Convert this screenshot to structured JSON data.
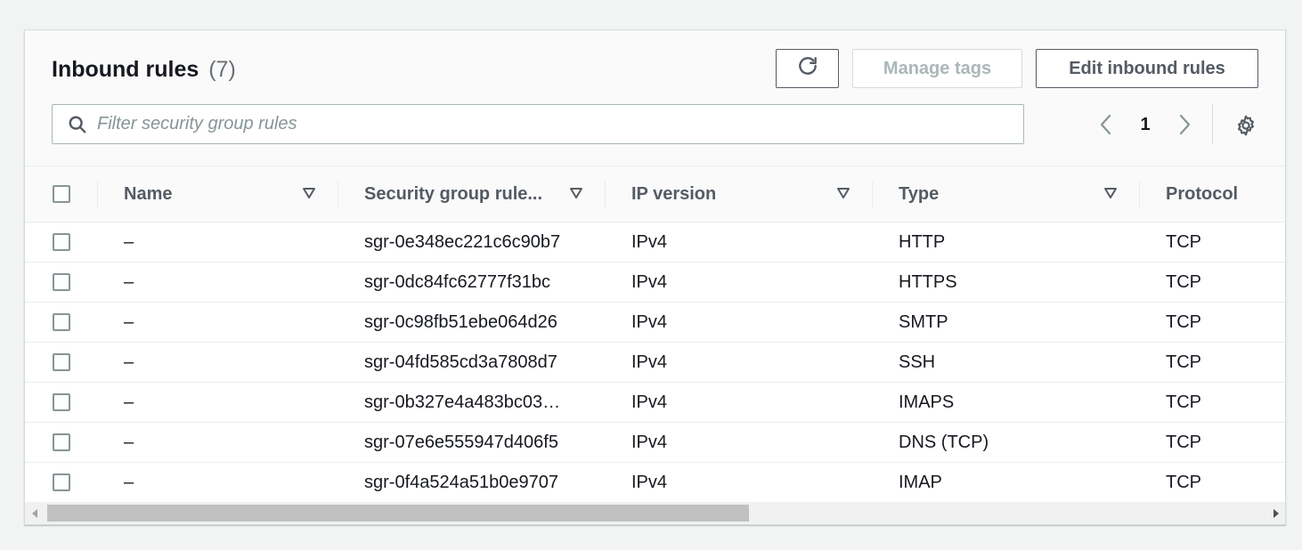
{
  "header": {
    "title": "Inbound rules",
    "count": "(7)",
    "manage_tags_label": "Manage tags",
    "edit_label": "Edit inbound rules"
  },
  "search": {
    "placeholder": "Filter security group rules",
    "value": ""
  },
  "pagination": {
    "current_page": "1"
  },
  "table": {
    "columns": [
      "Name",
      "Security group rule...",
      "IP version",
      "Type",
      "Protocol"
    ],
    "rows": [
      {
        "name": "–",
        "rule_id": "sgr-0e348ec221c6c90b7",
        "ip_version": "IPv4",
        "type": "HTTP",
        "protocol": "TCP"
      },
      {
        "name": "–",
        "rule_id": "sgr-0dc84fc62777f31bc",
        "ip_version": "IPv4",
        "type": "HTTPS",
        "protocol": "TCP"
      },
      {
        "name": "–",
        "rule_id": "sgr-0c98fb51ebe064d26",
        "ip_version": "IPv4",
        "type": "SMTP",
        "protocol": "TCP"
      },
      {
        "name": "–",
        "rule_id": "sgr-04fd585cd3a7808d7",
        "ip_version": "IPv4",
        "type": "SSH",
        "protocol": "TCP"
      },
      {
        "name": "–",
        "rule_id": "sgr-0b327e4a483bc03…",
        "ip_version": "IPv4",
        "type": "IMAPS",
        "protocol": "TCP"
      },
      {
        "name": "–",
        "rule_id": "sgr-07e6e555947d406f5",
        "ip_version": "IPv4",
        "type": "DNS (TCP)",
        "protocol": "TCP"
      },
      {
        "name": "–",
        "rule_id": "sgr-0f4a524a51b0e9707",
        "ip_version": "IPv4",
        "type": "IMAP",
        "protocol": "TCP"
      }
    ]
  },
  "colors": {
    "text_primary": "#16191f",
    "text_secondary": "#545b64",
    "border": "#eaeded",
    "disabled": "#aab7b8"
  },
  "icons": {
    "refresh": "refresh-icon",
    "search": "search-icon",
    "prev": "chevron-left-icon",
    "next": "chevron-right-icon",
    "settings": "gear-icon",
    "sort": "caret-down-icon"
  }
}
